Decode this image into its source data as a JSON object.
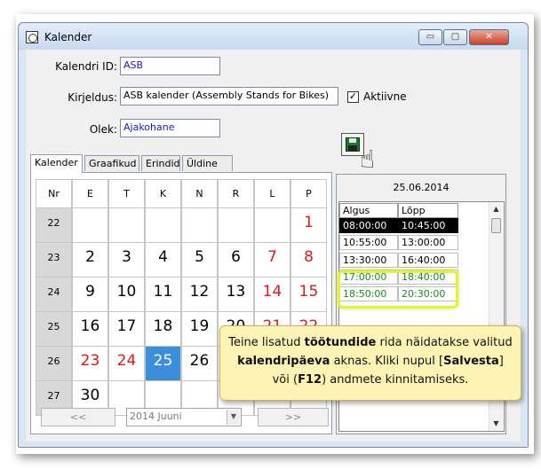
{
  "window": {
    "title": "Kalender",
    "icon": "calendar-app-icon",
    "buttons": {
      "minimize": "▭",
      "maximize": "▢",
      "close": "✕"
    }
  },
  "form": {
    "calendar_id_label": "Kalendri ID:",
    "calendar_id_value": "ASB",
    "description_label": "Kirjeldus:",
    "description_value": "ASB kalender (Assembly Stands for Bikes)",
    "active_label": "Aktiivne",
    "active_checked": "✓",
    "state_label": "Olek:",
    "state_value": "Ajakohane"
  },
  "tabs": [
    "Kalender",
    "Graafikud",
    "Erindid",
    "Üldine"
  ],
  "calendar": {
    "headers": [
      "Nr",
      "E",
      "T",
      "K",
      "N",
      "R",
      "L",
      "P"
    ],
    "weeks": [
      {
        "nr": "22",
        "days": [
          "",
          "",
          "",
          "",
          "",
          "",
          "1"
        ]
      },
      {
        "nr": "23",
        "days": [
          "2",
          "3",
          "4",
          "5",
          "6",
          "7",
          "8"
        ]
      },
      {
        "nr": "24",
        "days": [
          "9",
          "10",
          "11",
          "12",
          "13",
          "14",
          "15"
        ]
      },
      {
        "nr": "25",
        "days": [
          "16",
          "17",
          "18",
          "19",
          "20",
          "21",
          "22"
        ]
      },
      {
        "nr": "26",
        "days": [
          "23",
          "24",
          "25",
          "26",
          "",
          "",
          ""
        ]
      },
      {
        "nr": "27",
        "days": [
          "30",
          "",
          "",
          "",
          "",
          "",
          ""
        ]
      }
    ],
    "selected_day": "25",
    "red_days": [
      "1",
      "7",
      "8",
      "14",
      "15",
      "21",
      "22",
      "23",
      "24"
    ]
  },
  "nav": {
    "prev": "<<",
    "month": "2014 Juuni",
    "next": ">>"
  },
  "schedule": {
    "date": "25.06.2014",
    "columns": [
      "Algus",
      "Lõpp"
    ],
    "rows": [
      {
        "start": "08:00:00",
        "end": "10:45:00",
        "state": "selected"
      },
      {
        "start": "10:55:00",
        "end": "13:00:00",
        "state": "normal"
      },
      {
        "start": "13:30:00",
        "end": "16:40:00",
        "state": "normal"
      },
      {
        "start": "17:00:00",
        "end": "18:40:00",
        "state": "new"
      },
      {
        "start": "18:50:00",
        "end": "20:30:00",
        "state": "new"
      }
    ]
  },
  "tooltip": {
    "p1": "Teine lisatud ",
    "b1": "töötundide",
    "p2": " rida näidatakse valitud ",
    "b2": "kalendripäeva",
    "p3": " aknas. Kliki nupul [",
    "b3": "Salvesta",
    "p4": "] või (",
    "b4": "F12",
    "p5": ") andmete kinnitamiseks."
  },
  "icons": {
    "save": "floppy-disk-icon",
    "pointer": "hand-pointer-icon"
  },
  "colors": {
    "selected_day": "#3b8edb",
    "holiday": "#e01818",
    "new_row": "#1a8a1a",
    "highlight": "#e6f03a",
    "tooltip_bg": "#fdf3b4"
  }
}
